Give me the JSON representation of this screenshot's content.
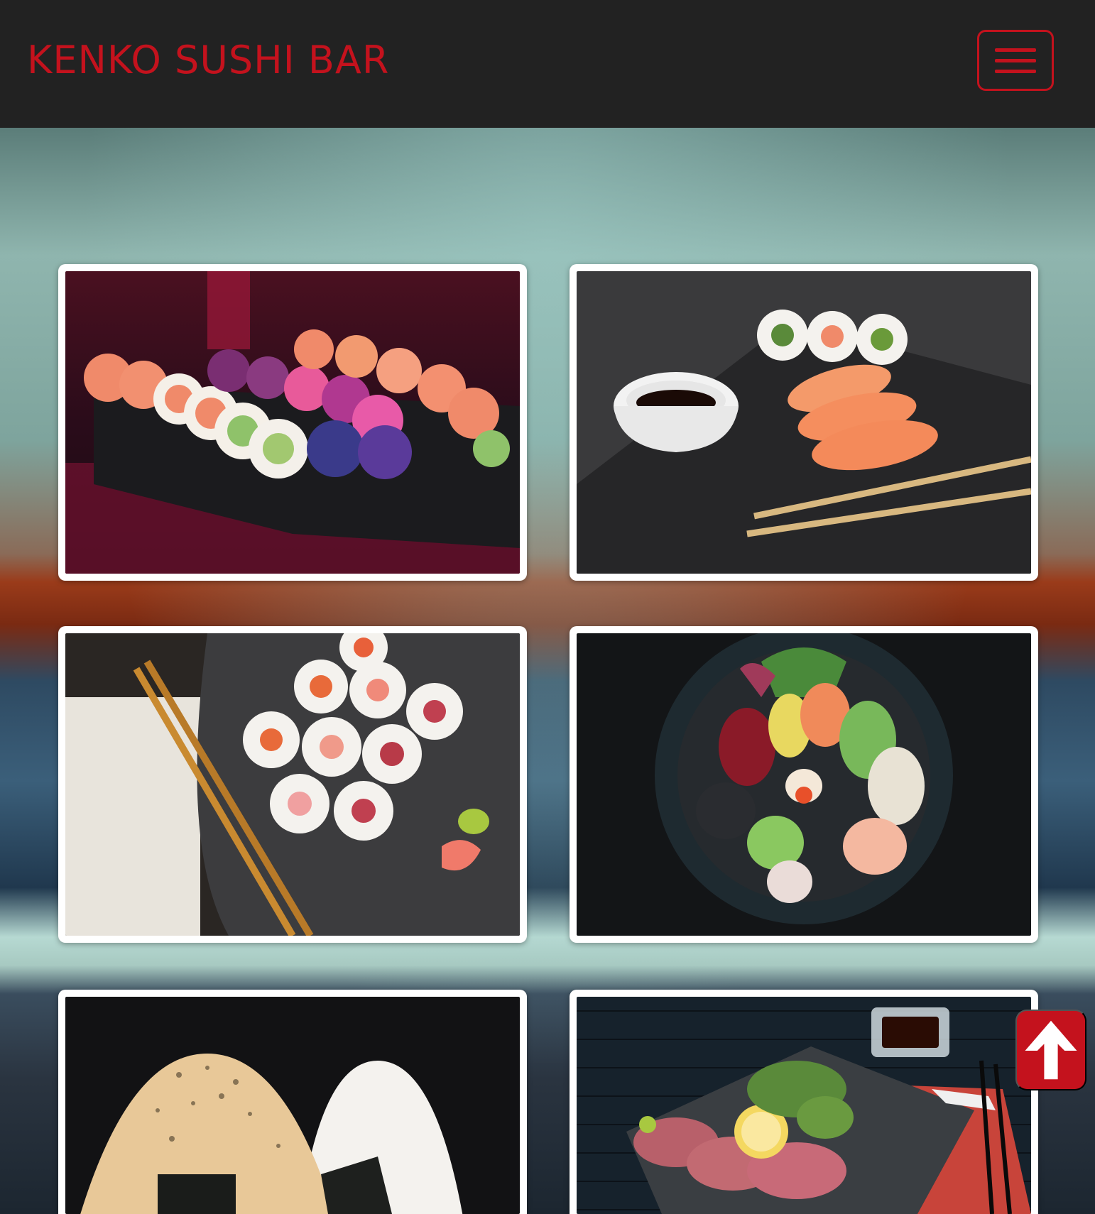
{
  "header": {
    "brand": "KENKO SUSHI BAR",
    "menu_icon": "hamburger-menu-icon"
  },
  "colors": {
    "brand_red": "#c4121d",
    "header_bg": "#222222",
    "card_border": "#ffffff"
  },
  "gallery": {
    "items": [
      {
        "subject": "sushi-rolls-on-tray"
      },
      {
        "subject": "nigiri-and-maki-with-soy-sauce-and-chopsticks"
      },
      {
        "subject": "maki-rolls-on-dark-plate-with-chopsticks"
      },
      {
        "subject": "sashimi-bowl"
      },
      {
        "subject": "onigiri-rice-balls"
      },
      {
        "subject": "seared-tuna-tataki-plate"
      }
    ]
  },
  "scroll_top": {
    "icon": "arrow-up-icon"
  }
}
